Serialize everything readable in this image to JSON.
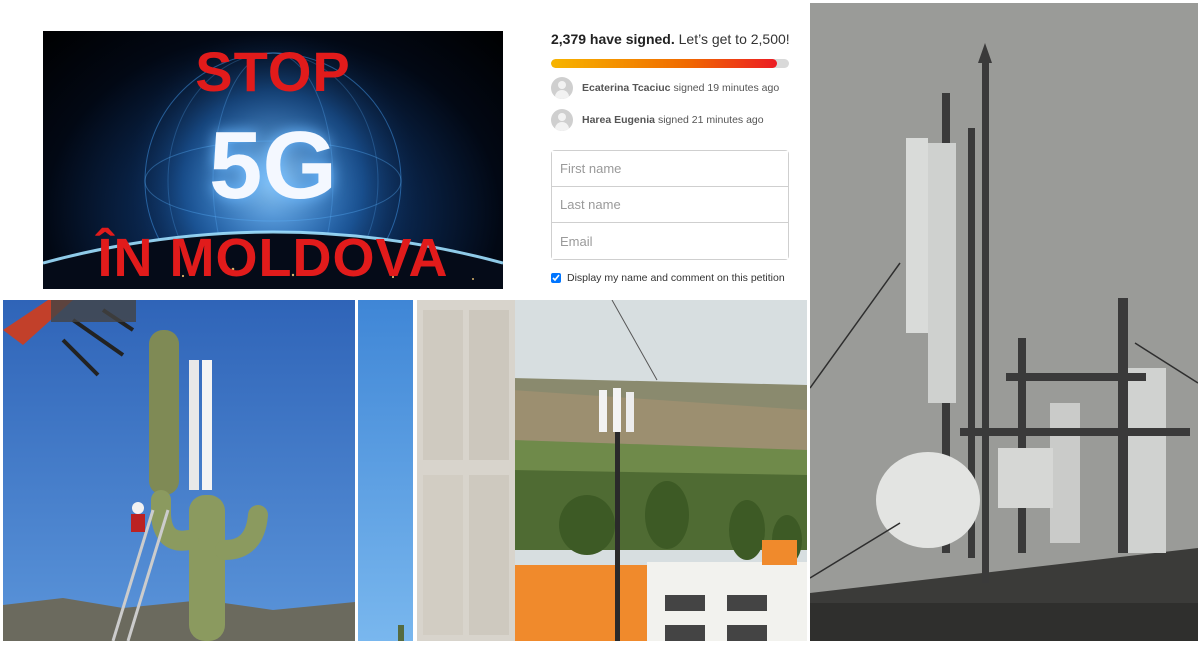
{
  "banner": {
    "line1": "STOP",
    "line2": "5G",
    "line3": "ÎN MOLDOVA"
  },
  "petition": {
    "signed_count": "2,379 have signed.",
    "goal_text": "Let’s get to 2,500!",
    "progress_fraction": 0.9516,
    "colors": {
      "progress_start": "#f7b500",
      "progress_end": "#ec1c24"
    },
    "recent_signers": [
      {
        "name": "Ecaterina Tcaciuc",
        "action": "signed 19 minutes ago"
      },
      {
        "name": "Harea Eugenia",
        "action": "signed 21 minutes ago"
      }
    ],
    "form": {
      "first_name_placeholder": "First name",
      "last_name_placeholder": "Last name",
      "email_placeholder": "Email"
    },
    "consent_label": "Display my name and comment on this petition",
    "consent_checked": true
  }
}
